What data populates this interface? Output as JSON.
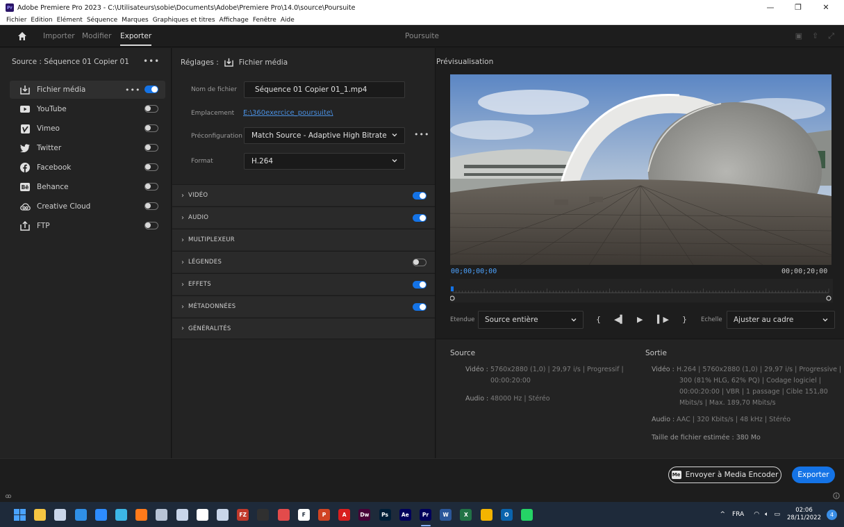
{
  "titlebar": {
    "app_icon": "Pr",
    "title": "Adobe Premiere Pro 2023 - C:\\Utilisateurs\\sobie\\Documents\\Adobe\\Premiere Pro\\14.0\\source\\Poursuite",
    "minimize": "—",
    "restore": "❐",
    "close": "✕"
  },
  "menu": [
    "Fichier",
    "Edition",
    "Elément",
    "Séquence",
    "Marques",
    "Graphiques et titres",
    "Affichage",
    "Fenêtre",
    "Aide"
  ],
  "header": {
    "tabs": [
      "Importer",
      "Modifier",
      "Exporter"
    ],
    "active_tab": "Exporter",
    "project_title": "Poursuite"
  },
  "left": {
    "source_label": "Source :  Séquence 01 Copier 01",
    "source_more": "•••",
    "destinations": [
      {
        "label": "Fichier média",
        "icon": "export-file-icon",
        "on": true,
        "more": "•••"
      },
      {
        "label": "YouTube",
        "icon": "youtube-icon",
        "on": false
      },
      {
        "label": "Vimeo",
        "icon": "vimeo-icon",
        "on": false
      },
      {
        "label": "Twitter",
        "icon": "twitter-icon",
        "on": false
      },
      {
        "label": "Facebook",
        "icon": "facebook-icon",
        "on": false
      },
      {
        "label": "Behance",
        "icon": "behance-icon",
        "on": false
      },
      {
        "label": "Creative Cloud",
        "icon": "creative-cloud-icon",
        "on": false
      },
      {
        "label": "FTP",
        "icon": "ftp-upload-icon",
        "on": false
      }
    ]
  },
  "settings": {
    "header_prefix": "Réglages :",
    "header_target": "Fichier média",
    "filename_label": "Nom de fichier",
    "filename_value": "Séquence 01 Copier 01_1.mp4",
    "location_label": "Emplacement",
    "location_value": "E:\\360exercice_poursuite\\",
    "preset_label": "Préconfiguration",
    "preset_value": "Match Source - Adaptive High Bitrate",
    "preset_more": "•••",
    "format_label": "Format",
    "format_value": "H.264",
    "sections": [
      {
        "label": "VIDÉO",
        "toggle": "on"
      },
      {
        "label": "AUDIO",
        "toggle": "on"
      },
      {
        "label": "MULTIPLEXEUR",
        "toggle": "none"
      },
      {
        "label": "LÉGENDES",
        "toggle": "off"
      },
      {
        "label": "EFFETS",
        "toggle": "on"
      },
      {
        "label": "MÉTADONNÉES",
        "toggle": "on"
      },
      {
        "label": "GÉNÉRALITÉS",
        "toggle": "none"
      }
    ]
  },
  "preview": {
    "title": "Prévisualisation",
    "timecode_start": "00;00;00;00",
    "timecode_end": "00;00;20;00",
    "range_label": "Etendue",
    "range_value": "Source entière",
    "scale_label": "Echelle",
    "scale_value": "Ajuster au cadre"
  },
  "summary": {
    "source_title": "Source",
    "source_video_label": "Vidéo :",
    "source_video_lines": [
      "5760x2880 (1,0)  |  29,97 i/s  |  Progressif  |",
      "00:00:20:00"
    ],
    "source_audio_label": "Audio :",
    "source_audio": "48000 Hz  |  Stéréo",
    "output_title": "Sortie",
    "output_video_label": "Vidéo :",
    "output_video_lines": [
      "H.264  |  5760x2880 (1,0)  |  29,97 i/s  |  Progressive  |",
      "300 (81% HLG, 62% PQ)  |  Codage logiciel  |",
      "00:00:20:00  |  VBR  |  1 passage  |  Cible 151,80",
      "Mbits/s  |  Max. 189,70 Mbits/s"
    ],
    "output_audio_label": "Audio :",
    "output_audio": "AAC  |  320 Kbits/s  |  48 kHz  |  Stéréo",
    "filesize": "Taille de fichier estimée :  380 Mo"
  },
  "actions": {
    "ame_icon": "Me",
    "send_to_ame": "Envoyer à Media Encoder",
    "export": "Exporter"
  },
  "taskbar": {
    "apps": [
      {
        "name": "windows-start-icon",
        "color": "#4aa3ff",
        "text": ""
      },
      {
        "name": "file-explorer-icon",
        "color": "#f5c542",
        "text": ""
      },
      {
        "name": "app-icon-3",
        "color": "#c9d6ea",
        "text": ""
      },
      {
        "name": "app-icon-4",
        "color": "#2f8fe6",
        "text": ""
      },
      {
        "name": "zoom-icon",
        "color": "#2d8cff",
        "text": ""
      },
      {
        "name": "app-icon-6",
        "color": "#3cb6e6",
        "text": ""
      },
      {
        "name": "firefox-icon",
        "color": "#ff7a1a",
        "text": ""
      },
      {
        "name": "calculator-icon",
        "color": "#b8c4d6",
        "text": ""
      },
      {
        "name": "app-icon-9",
        "color": "#c9d6ea",
        "text": ""
      },
      {
        "name": "app-icon-10",
        "color": "#ffffff",
        "text": ""
      },
      {
        "name": "app-icon-11",
        "color": "#c9d6ea",
        "text": ""
      },
      {
        "name": "filezilla-icon",
        "color": "#c0392b",
        "text": "FZ"
      },
      {
        "name": "obs-icon",
        "color": "#303030",
        "text": ""
      },
      {
        "name": "app-icon-14",
        "color": "#e34b4b",
        "text": ""
      },
      {
        "name": "app-icon-15",
        "color": "#ffffff",
        "text": "F"
      },
      {
        "name": "powerpoint-icon",
        "color": "#d04423",
        "text": "P"
      },
      {
        "name": "acrobat-icon",
        "color": "#d91e1e",
        "text": "A"
      },
      {
        "name": "dreamweaver-icon",
        "color": "#470137",
        "text": "Dw"
      },
      {
        "name": "photoshop-icon",
        "color": "#001e36",
        "text": "Ps"
      },
      {
        "name": "after-effects-icon",
        "color": "#00005b",
        "text": "Ae"
      },
      {
        "name": "premiere-icon",
        "color": "#00005b",
        "text": "Pr"
      },
      {
        "name": "word-icon",
        "color": "#2b579a",
        "text": "W"
      },
      {
        "name": "excel-icon",
        "color": "#217346",
        "text": "X"
      },
      {
        "name": "chrome-icon",
        "color": "#f4b400",
        "text": ""
      },
      {
        "name": "outlook-icon",
        "color": "#0a64ad",
        "text": "O"
      },
      {
        "name": "whatsapp-icon",
        "color": "#25d366",
        "text": ""
      }
    ],
    "tray_chevron": "^",
    "lang": "FRA",
    "time": "02:06",
    "date": "28/11/2022",
    "notifications": "4"
  }
}
